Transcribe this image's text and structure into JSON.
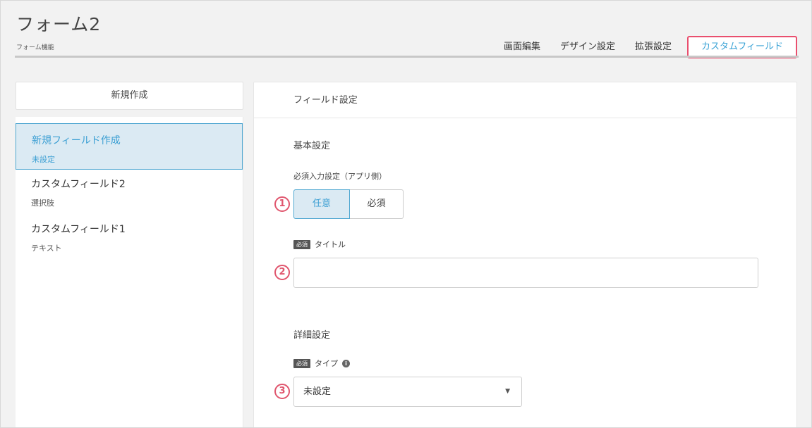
{
  "header": {
    "title": "フォーム2",
    "subtitle": "フォーム機能",
    "tabs": [
      {
        "label": "画面編集"
      },
      {
        "label": "デザイン設定"
      },
      {
        "label": "拡張設定"
      },
      {
        "label": "カスタムフィールド",
        "active": true
      }
    ]
  },
  "sidebar": {
    "new_button": "新規作成",
    "items": [
      {
        "name": "新規フィールド作成",
        "sub": "未設定",
        "selected": true
      },
      {
        "name": "カスタムフィールド2",
        "sub": "選択肢"
      },
      {
        "name": "カスタムフィールド1",
        "sub": "テキスト"
      }
    ]
  },
  "panel": {
    "heading": "フィールド設定",
    "basic_section": "基本設定",
    "required_label": "必須入力設定（アプリ側）",
    "required_options": [
      "任意",
      "必須"
    ],
    "required_selected": "任意",
    "required_badge": "必須",
    "title_label": "タイトル",
    "title_value": "",
    "detail_section": "詳細設定",
    "type_label": "タイプ",
    "type_info_icon": "i",
    "type_value": "未設定",
    "caret": "▼"
  },
  "markers": [
    "1",
    "2",
    "3"
  ],
  "colors": {
    "accent": "#3b9fd3",
    "highlight": "#e94f6e",
    "selected_bg": "#dbeaf3"
  }
}
